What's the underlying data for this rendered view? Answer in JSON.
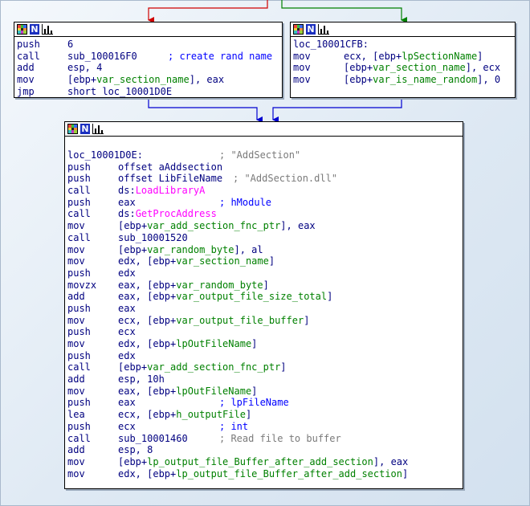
{
  "colors": {
    "edge_false": "#d00000",
    "edge_true": "#008000",
    "edge_uncond": "#0000d0",
    "mnemonic": "#000080",
    "variable": "#008000",
    "import": "#ff00ff",
    "comment": "#0000ff",
    "string_comment": "#7a7a7a"
  },
  "header_icons": [
    "graph-palette-icon",
    "name-n-icon",
    "graph-overview-icon"
  ],
  "block_left": {
    "lines": [
      {
        "mn": "push",
        "op": [
          {
            "t": "6"
          }
        ]
      },
      {
        "mn": "call",
        "op": [
          {
            "t": "sub_100016F0"
          }
        ],
        "cm": "; create rand name",
        "cmc": "cm"
      },
      {
        "mn": "add",
        "op": [
          {
            "t": "esp, 4"
          }
        ]
      },
      {
        "mn": "mov",
        "op": [
          {
            "t": "["
          },
          {
            "t": "ebp+"
          },
          {
            "t": "var_section_name",
            "c": "v"
          },
          {
            "t": "], eax"
          }
        ]
      },
      {
        "mn": "jmp",
        "op": [
          {
            "t": "short loc_10001D0E"
          }
        ]
      }
    ]
  },
  "block_right": {
    "label": "loc_10001CFB:",
    "lines": [
      {
        "mn": "mov",
        "op": [
          {
            "t": "ecx, [ebp+"
          },
          {
            "t": "lpSectionName",
            "c": "v"
          },
          {
            "t": "]"
          }
        ]
      },
      {
        "mn": "mov",
        "op": [
          {
            "t": "[ebp+"
          },
          {
            "t": "var_section_name",
            "c": "v"
          },
          {
            "t": "], ecx"
          }
        ]
      },
      {
        "mn": "mov",
        "op": [
          {
            "t": "[ebp+"
          },
          {
            "t": "var_is_name_random",
            "c": "v"
          },
          {
            "t": "], 0"
          }
        ]
      }
    ]
  },
  "block_main": {
    "label": "loc_10001D0E:",
    "label_comment": "; \"AddSection\"",
    "lines": [
      {
        "mn": "push",
        "op": [
          {
            "t": "offset aAddsection"
          }
        ]
      },
      {
        "mn": "push",
        "op": [
          {
            "t": "offset LibFileName"
          }
        ],
        "cm": "; \"AddSection.dll\"",
        "cmc": "cmg",
        "cmx": 206
      },
      {
        "mn": "call",
        "op": [
          {
            "t": "ds:"
          },
          {
            "t": "LoadLibraryA",
            "c": "f"
          }
        ]
      },
      {
        "mn": "push",
        "op": [
          {
            "t": "eax"
          }
        ],
        "cm": "; hModule",
        "cmc": "cm"
      },
      {
        "mn": "call",
        "op": [
          {
            "t": "ds:"
          },
          {
            "t": "GetProcAddress",
            "c": "f"
          }
        ]
      },
      {
        "mn": "mov",
        "op": [
          {
            "t": "[ebp+"
          },
          {
            "t": "var_add_section_fnc_ptr",
            "c": "v"
          },
          {
            "t": "], eax"
          }
        ]
      },
      {
        "mn": "call",
        "op": [
          {
            "t": "sub_10001520"
          }
        ]
      },
      {
        "mn": "mov",
        "op": [
          {
            "t": "[ebp+"
          },
          {
            "t": "var_random_byte",
            "c": "v"
          },
          {
            "t": "], al"
          }
        ]
      },
      {
        "mn": "mov",
        "op": [
          {
            "t": "edx, [ebp+"
          },
          {
            "t": "var_section_name",
            "c": "v"
          },
          {
            "t": "]"
          }
        ]
      },
      {
        "mn": "push",
        "op": [
          {
            "t": "edx"
          }
        ]
      },
      {
        "mn": "movzx",
        "op": [
          {
            "t": "eax, [ebp+"
          },
          {
            "t": "var_random_byte",
            "c": "v"
          },
          {
            "t": "]"
          }
        ]
      },
      {
        "mn": "add",
        "op": [
          {
            "t": "eax, [ebp+"
          },
          {
            "t": "var_output_file_size_total",
            "c": "v"
          },
          {
            "t": "]"
          }
        ]
      },
      {
        "mn": "push",
        "op": [
          {
            "t": "eax"
          }
        ]
      },
      {
        "mn": "mov",
        "op": [
          {
            "t": "ecx, [ebp+"
          },
          {
            "t": "var_output_file_buffer",
            "c": "v"
          },
          {
            "t": "]"
          }
        ]
      },
      {
        "mn": "push",
        "op": [
          {
            "t": "ecx"
          }
        ]
      },
      {
        "mn": "mov",
        "op": [
          {
            "t": "edx, [ebp+"
          },
          {
            "t": "lpOutFileName",
            "c": "v"
          },
          {
            "t": "]"
          }
        ]
      },
      {
        "mn": "push",
        "op": [
          {
            "t": "edx"
          }
        ]
      },
      {
        "mn": "call",
        "op": [
          {
            "t": "[ebp+"
          },
          {
            "t": "var_add_section_fnc_ptr",
            "c": "v"
          },
          {
            "t": "]"
          }
        ]
      },
      {
        "mn": "add",
        "op": [
          {
            "t": "esp, 10h"
          }
        ]
      },
      {
        "mn": "mov",
        "op": [
          {
            "t": "eax, [ebp+"
          },
          {
            "t": "lpOutFileName",
            "c": "v"
          },
          {
            "t": "]"
          }
        ]
      },
      {
        "mn": "push",
        "op": [
          {
            "t": "eax"
          }
        ],
        "cm": "; lpFileName",
        "cmc": "cm"
      },
      {
        "mn": "lea",
        "op": [
          {
            "t": "ecx, [ebp+"
          },
          {
            "t": "h_outputFile",
            "c": "v"
          },
          {
            "t": "]"
          }
        ]
      },
      {
        "mn": "push",
        "op": [
          {
            "t": "ecx"
          }
        ],
        "cm": "; int",
        "cmc": "cm"
      },
      {
        "mn": "call",
        "op": [
          {
            "t": "sub_10001460"
          }
        ],
        "cm": "; Read file to buffer",
        "cmc": "cmg"
      },
      {
        "mn": "add",
        "op": [
          {
            "t": "esp, 8"
          }
        ]
      },
      {
        "mn": "mov",
        "op": [
          {
            "t": "[ebp+"
          },
          {
            "t": "lp_output_file_Buffer_after_add_section",
            "c": "v"
          },
          {
            "t": "], eax"
          }
        ]
      },
      {
        "mn": "mov",
        "op": [
          {
            "t": "edx, [ebp+"
          },
          {
            "t": "lp_output_file_Buffer_after_add_section",
            "c": "v"
          },
          {
            "t": "]"
          }
        ]
      }
    ]
  }
}
